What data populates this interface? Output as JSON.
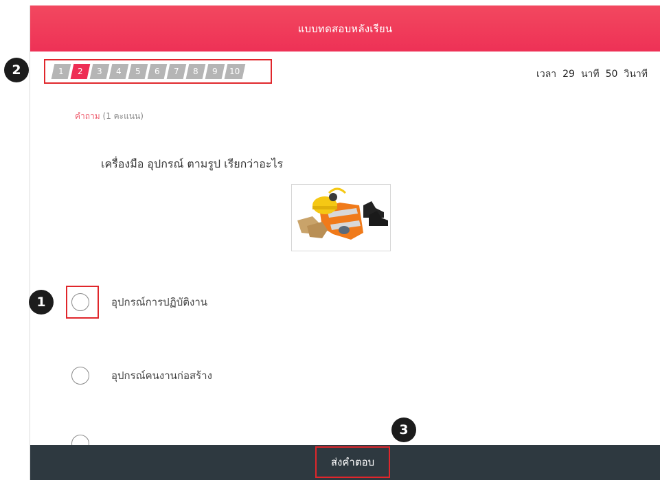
{
  "header": {
    "title": "แบบทดสอบหลังเรียน"
  },
  "callouts": {
    "one": "1",
    "two": "2",
    "three": "3"
  },
  "question_nav": {
    "items": [
      "1",
      "2",
      "3",
      "4",
      "5",
      "6",
      "7",
      "8",
      "9",
      "10"
    ],
    "active_index": 1
  },
  "timer": {
    "label": "เวลา",
    "minutes": "29",
    "minutes_unit": "นาที",
    "seconds": "50",
    "seconds_unit": "วินาที"
  },
  "question": {
    "label_word": "คำถาม",
    "points": "(1 คะแนน)",
    "text": "เครื่องมือ อุปกรณ์ ตามรูป เรียกว่าอะไร"
  },
  "options": [
    {
      "label": "อุปกรณ์การปฏิบัติงาน",
      "selected": false
    },
    {
      "label": "อุปกรณ์คนงานก่อสร้าง",
      "selected": false
    }
  ],
  "footer": {
    "submit_label": "ส่งคำตอบ"
  },
  "colors": {
    "header_accent": "#ee3156",
    "active_nav": "#ee2e55",
    "inactive_nav": "#b5b5b5",
    "footer_bg": "#2e3940",
    "highlight_box": "#e0262b"
  }
}
